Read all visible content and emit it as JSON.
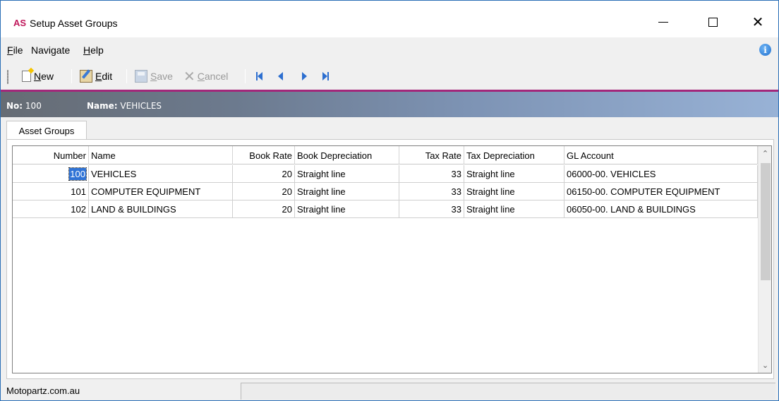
{
  "window": {
    "logo": "AS",
    "title": "Setup Asset Groups",
    "accent_color": "#a3277a",
    "logo_color": "#c0185b"
  },
  "menu": {
    "items": [
      {
        "label": "File",
        "accel": "F",
        "rest": "ile"
      },
      {
        "label": "Navigate",
        "accel": "",
        "rest": "Navigate"
      },
      {
        "label": "Help",
        "accel": "H",
        "rest": "elp"
      }
    ],
    "info_icon": "info-icon"
  },
  "toolbar": {
    "new": {
      "accel": "N",
      "rest": "ew",
      "icon": "new-document-icon"
    },
    "edit": {
      "accel": "E",
      "rest": "dit",
      "icon": "edit-icon"
    },
    "save": {
      "accel": "S",
      "rest": "ave",
      "icon": "save-icon"
    },
    "cancel": {
      "accel": "C",
      "rest": "ancel",
      "icon": "cancel-icon"
    },
    "nav": [
      "first-record-icon",
      "previous-record-icon",
      "next-record-icon",
      "last-record-icon"
    ]
  },
  "header": {
    "no_label": "No:",
    "no_value": "100",
    "name_label": "Name:",
    "name_value": "VEHICLES"
  },
  "tabs": [
    {
      "label": "Asset Groups",
      "active": true
    }
  ],
  "grid": {
    "columns": [
      "Number",
      "Name",
      "Book Rate",
      "Book Depreciation",
      "Tax Rate",
      "Tax Depreciation",
      "GL Account"
    ],
    "rows": [
      [
        "100",
        "VEHICLES",
        "20",
        "Straight line",
        "33",
        "Straight line",
        "06000-00. VEHICLES"
      ],
      [
        "101",
        "COMPUTER EQUIPMENT",
        "20",
        "Straight line",
        "33",
        "Straight line",
        "06150-00. COMPUTER EQUIPMENT"
      ],
      [
        "102",
        "LAND & BUILDINGS",
        "20",
        "Straight line",
        "33",
        "Straight line",
        "06050-00. LAND & BUILDINGS"
      ]
    ],
    "selected_row": 0
  },
  "status": {
    "left": "Motopartz.com.au",
    "right": ""
  }
}
